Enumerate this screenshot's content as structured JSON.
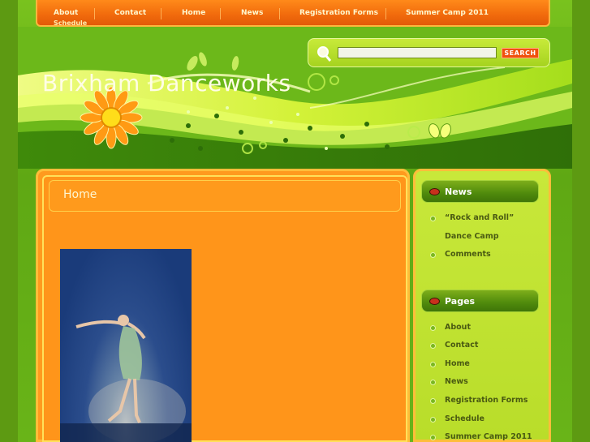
{
  "nav": {
    "items": [
      "About",
      "Contact",
      "Home",
      "News",
      "Registration Forms",
      "Summer Camp 2011"
    ],
    "overflow_item": "Schedule"
  },
  "header": {
    "site_title": "Brixham Danceworks"
  },
  "search": {
    "value": "",
    "button_label": "SEARCH"
  },
  "content": {
    "post_title": "Home"
  },
  "sidebar": {
    "news": {
      "title": "News",
      "items": [
        "“Rock and Roll”",
        "Dance Camp",
        "Comments"
      ]
    },
    "pages": {
      "title": "Pages",
      "items": [
        "About",
        "Contact",
        "Home",
        "News",
        "Registration Forms",
        "Schedule",
        "Summer Camp 2011"
      ]
    }
  },
  "colors": {
    "nav_bg": "#f16a0c",
    "content_bg": "#ff951a",
    "sidebar_bg": "#c8e83a",
    "page_bg": "#5d9a12",
    "link_text": "#4a5a12"
  }
}
